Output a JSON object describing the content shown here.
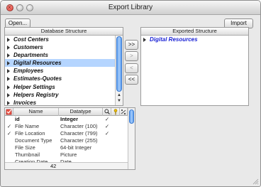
{
  "window": {
    "title": "Export Library"
  },
  "toolbar": {
    "open_label": "Open...",
    "import_label": "Import"
  },
  "database_panel": {
    "header": "Database Structure",
    "items": [
      {
        "label": "Cost Centers",
        "selected": false
      },
      {
        "label": "Customers",
        "selected": false
      },
      {
        "label": "Departments",
        "selected": false
      },
      {
        "label": "Digital Resources",
        "selected": true
      },
      {
        "label": "Employees",
        "selected": false
      },
      {
        "label": "Estimates-Quotes",
        "selected": false
      },
      {
        "label": "Helper Settings",
        "selected": false
      },
      {
        "label": "Helpers Registry",
        "selected": false
      },
      {
        "label": "Invoices",
        "selected": false
      }
    ]
  },
  "transfer_buttons": {
    "add_all": ">>",
    "add": ">",
    "remove": "<",
    "remove_all": "<<"
  },
  "exported_panel": {
    "header": "Exported Structure",
    "items": [
      {
        "label": "Digital Resources"
      }
    ]
  },
  "fields_grid": {
    "columns": {
      "name": "Name",
      "datatype": "Datatype"
    },
    "rows": [
      {
        "check": "",
        "name": "id",
        "datatype": "Integer",
        "bold": true,
        "flag_indexed": "✓",
        "flag_key": "",
        "flag_other": ""
      },
      {
        "check": "✓",
        "name": "File Name",
        "datatype": "Character (100)",
        "bold": false,
        "flag_indexed": "✓",
        "flag_key": "",
        "flag_other": ""
      },
      {
        "check": "✓",
        "name": "File Location",
        "datatype": "Character (799)",
        "bold": false,
        "flag_indexed": "✓",
        "flag_key": "",
        "flag_other": ""
      },
      {
        "check": "",
        "name": "Document Type",
        "datatype": "Character (255)",
        "bold": false,
        "flag_indexed": "",
        "flag_key": "",
        "flag_other": ""
      },
      {
        "check": "",
        "name": "File Size",
        "datatype": "64-bit Integer",
        "bold": false,
        "flag_indexed": "",
        "flag_key": "",
        "flag_other": ""
      },
      {
        "check": "",
        "name": "Thumbnail",
        "datatype": "Picture",
        "bold": false,
        "flag_indexed": "",
        "flag_key": "",
        "flag_other": ""
      },
      {
        "check": "",
        "name": "Creation Date",
        "datatype": "Date",
        "bold": false,
        "flag_indexed": "",
        "flag_key": "",
        "flag_other": ""
      }
    ],
    "footer_count": "42"
  },
  "colors": {
    "selection": "#b5d5ff",
    "exported_text": "#1b23d6",
    "scroll_thumb": "#5c9ef0"
  }
}
